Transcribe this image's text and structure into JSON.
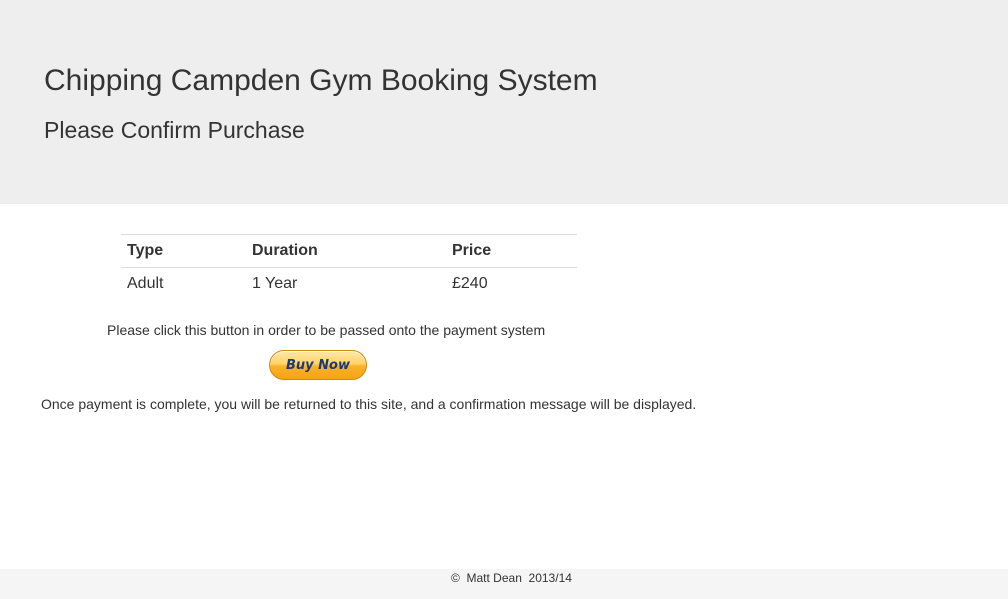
{
  "header": {
    "title": "Chipping Campden Gym Booking System",
    "subtitle": "Please Confirm Purchase"
  },
  "order_table": {
    "columns": [
      "Type",
      "Duration",
      "Price"
    ],
    "rows": [
      [
        "Adult",
        "1 Year",
        "£240"
      ]
    ]
  },
  "payment": {
    "instruction": "Please click this button in order to be passed onto the payment system",
    "button_label": "Buy Now",
    "notice": "Once payment is complete, you will be returned to this site, and a confirmation message will be displayed."
  },
  "footer": {
    "text": "©  Matt Dean  2013/14"
  },
  "colors": {
    "hero_background": "#eeeeee",
    "footer_background": "#f5f5f5",
    "button_gold": "#f9b227",
    "button_text": "#1b3a76"
  }
}
